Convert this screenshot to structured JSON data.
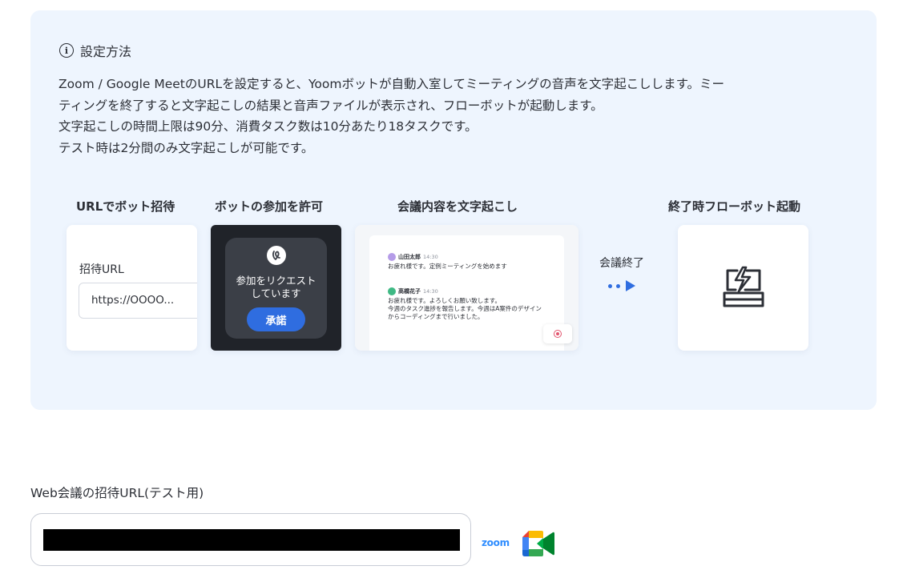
{
  "info": {
    "title": "設定方法",
    "icon": "info-circle-icon",
    "lines": [
      "Zoom / Google MeetのURLを設定すると、Yoomボットが自動入室してミーティングの音声を文字起こしします。ミー",
      "ティングを終了すると文字起こしの結果と音声ファイルが表示され、フローボットが起動します。",
      "文字起こしの時間上限は90分、消費タスク数は10分あたり18タスクです。",
      "テスト時は2分間のみ文字起こしが可能です。"
    ]
  },
  "steps": [
    {
      "label": "URLでボット招待"
    },
    {
      "label": "ボットの参加を許可"
    },
    {
      "label": "会議内容を文字起こし"
    },
    {
      "label": "終了時フローボット起動"
    }
  ],
  "invite_card": {
    "label": "招待URL",
    "url": "https://OOOO..."
  },
  "bot_card": {
    "request_line1": "参加をリクエスト",
    "request_line2": "しています",
    "approve_label": "承諾"
  },
  "transcript_card": {
    "messages": [
      {
        "name": "山田太郎",
        "time": "14:30",
        "lines": [
          "お疲れ様です。定例ミーティングを始めます"
        ]
      },
      {
        "name": "高橋花子",
        "time": "14:30",
        "lines": [
          "お疲れ様です。よろしくお願い致します。",
          "今週のタスク進捗を報告します。今週はA案件のデザイン",
          "からコーディングまで行いました。"
        ]
      }
    ]
  },
  "end_label": "会議終了",
  "url_field": {
    "label": "Web会議の招待URL(テスト用)",
    "value_redacted": true
  },
  "logos": {
    "zoom": "zoom",
    "meet": "google-meet-icon"
  },
  "colors": {
    "accent": "#2f6de0",
    "panel_bg": "#eef5fe",
    "dark_card": "#202329",
    "record": "#e2546d",
    "zoom_blue": "#2d8cff"
  }
}
